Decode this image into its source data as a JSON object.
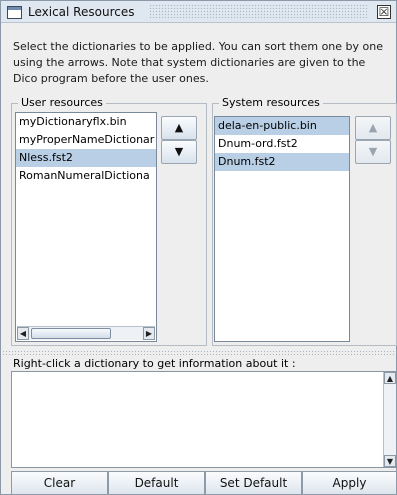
{
  "window": {
    "title": "Lexical Resources",
    "close_glyph": "☒"
  },
  "description": "Select the dictionaries to be applied. You can sort them one by one using the arrows. Note that system dictionaries are given to the Dico program before the user ones.",
  "user_resources": {
    "label": "User resources",
    "items": [
      {
        "text": "myDictionaryflx.bin",
        "selected": false
      },
      {
        "text": "myProperNameDictionar",
        "selected": false
      },
      {
        "text": "Nless.fst2",
        "selected": true
      },
      {
        "text": "RomanNumeralDictiona",
        "selected": false
      }
    ],
    "up_arrow": "▲",
    "down_arrow": "▼"
  },
  "system_resources": {
    "label": "System resources",
    "items": [
      {
        "text": "dela-en-public.bin",
        "selected": true
      },
      {
        "text": "Dnum-ord.fst2",
        "selected": false
      },
      {
        "text": "Dnum.fst2",
        "selected": true
      }
    ],
    "up_arrow": "▲",
    "down_arrow": "▼"
  },
  "scroll_glyphs": {
    "left": "◀",
    "right": "▶",
    "up": "▲",
    "down": "▼"
  },
  "info": {
    "label": "Right-click a dictionary to get information about it :"
  },
  "buttons": {
    "clear": "Clear",
    "default": "Default",
    "set_default": "Set Default",
    "apply": "Apply"
  }
}
